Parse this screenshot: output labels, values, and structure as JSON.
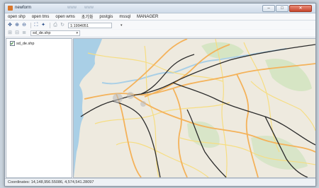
{
  "window": {
    "title": "newform",
    "ghost_tabs": [
      "www",
      "www"
    ]
  },
  "menu": [
    "open shp",
    "open tms",
    "open wms",
    "초기화",
    "postgis",
    "mssql",
    "MANAGER"
  ],
  "toolbar": {
    "tools": [
      "pan-icon",
      "zoom-in-icon",
      "zoom-out-icon",
      "full-extent-icon",
      "identify-icon",
      "print-icon",
      "refresh-icon"
    ],
    "scale": "1:1994051"
  },
  "toolbar2": {
    "tools": [
      "add-layer-icon",
      "remove-layer-icon",
      "properties-icon"
    ],
    "layer": "sd_de.shp"
  },
  "toc": {
    "layers": [
      {
        "label": "sd_de.shp",
        "checked": true
      }
    ]
  },
  "status": {
    "coordinates": "Coordinates: 14,148,956.55086, 4,574,541.28097"
  },
  "colors": {
    "map_bg": "#eeeadf",
    "road_orange": "#f4b25a",
    "road_yellow": "#f6dd82",
    "rail_black": "#2b2b2b",
    "water": "#a9cfe6",
    "green": "#cfe3bd"
  }
}
